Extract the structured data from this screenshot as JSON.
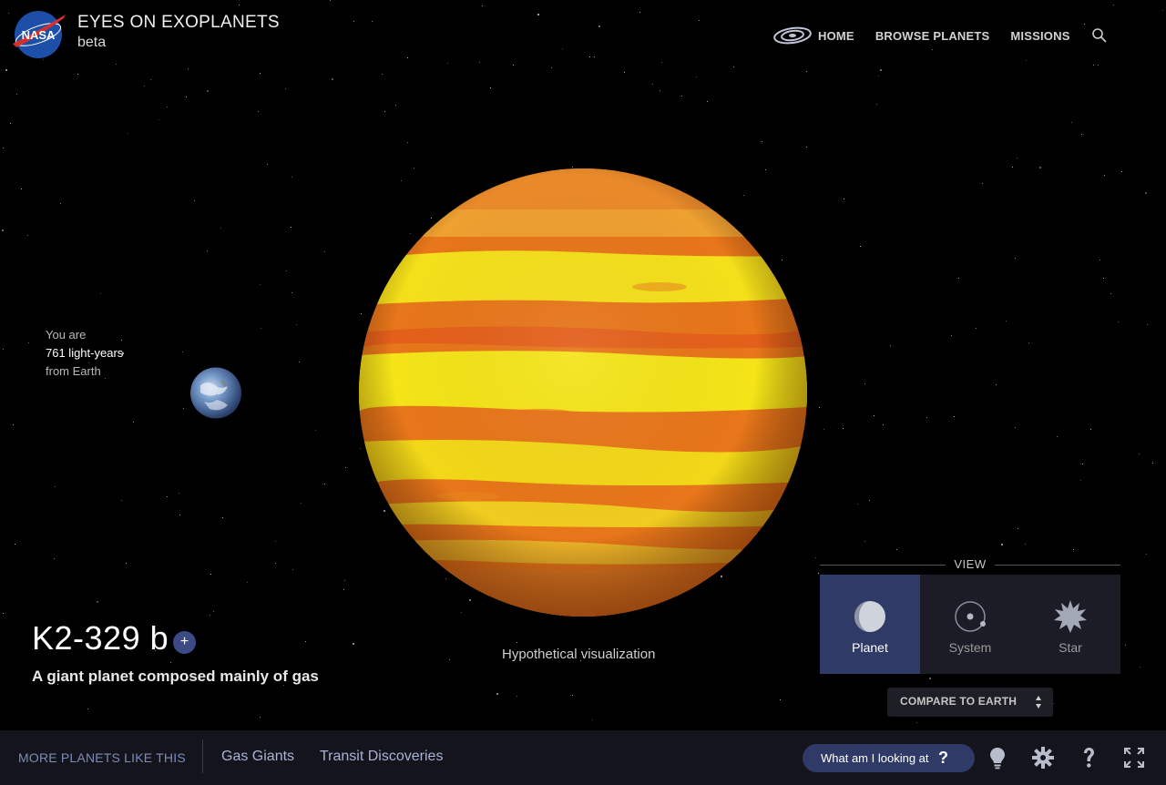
{
  "header": {
    "logo_text": "NASA",
    "title": "EYES ON EXOPLANETS",
    "subtitle": "beta"
  },
  "nav": {
    "items": [
      {
        "label": "HOME",
        "icon": "galaxy-icon"
      },
      {
        "label": "BROWSE PLANETS"
      },
      {
        "label": "MISSIONS"
      }
    ],
    "search_icon": "search-icon"
  },
  "distance": {
    "line1": "You are",
    "line2": "761 light-years",
    "line3": "from Earth"
  },
  "planet": {
    "name": "K2-329 b",
    "description": "A giant planet composed mainly of gas",
    "visualization_note": "Hypothetical visualization",
    "colors": {
      "band_light": "#f4e01a",
      "band_dark": "#e8761a"
    }
  },
  "view": {
    "label": "VIEW",
    "options": [
      {
        "label": "Planet",
        "icon": "planet-icon",
        "active": true
      },
      {
        "label": "System",
        "icon": "system-icon",
        "active": false
      },
      {
        "label": "Star",
        "icon": "star-icon",
        "active": false
      }
    ],
    "compare_label": "COMPARE TO EARTH"
  },
  "bottom": {
    "more_label": "MORE PLANETS LIKE THIS",
    "tags": [
      "Gas Giants",
      "Transit Discoveries"
    ],
    "help_button": "What am I looking at",
    "help_glyph": "?",
    "controls": [
      "lightbulb-icon",
      "settings-gear-icon",
      "help-icon",
      "fullscreen-icon"
    ]
  },
  "theme": {
    "accent": "#2f3a66",
    "bar_bg": "#14141c",
    "tag_color": "#a9b2d6"
  }
}
